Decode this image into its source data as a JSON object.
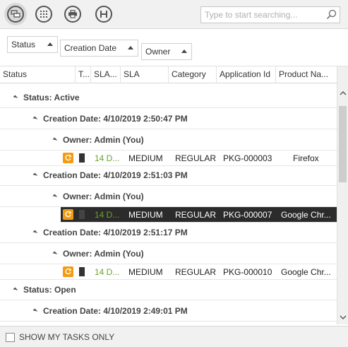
{
  "toolbar": {
    "buttons": [
      {
        "name": "expand-all-icon",
        "active": true
      },
      {
        "name": "columns-icon",
        "active": false
      },
      {
        "name": "print-icon",
        "active": false
      },
      {
        "name": "history-icon",
        "active": false
      }
    ],
    "search_placeholder": "Type to start searching..."
  },
  "group_by": [
    "Status",
    "Creation Date",
    "Owner"
  ],
  "columns": [
    "Status",
    "T...",
    "SLA...",
    "SLA",
    "Category",
    "Application Id",
    "Product Na..."
  ],
  "rows": [
    {
      "kind": "group",
      "level": 0,
      "label": "Status: Active"
    },
    {
      "kind": "group",
      "level": 1,
      "label": "Creation Date: 4/10/2019 2:50:47 PM"
    },
    {
      "kind": "group",
      "level": 2,
      "label": "Owner: Admin (You)"
    },
    {
      "kind": "data",
      "sla_due": "14 D...",
      "sla": "MEDIUM",
      "category": "REGULAR",
      "app_id": "PKG-000003",
      "product": "Firefox",
      "selected": false
    },
    {
      "kind": "group",
      "level": 1,
      "label": "Creation Date: 4/10/2019 2:51:03 PM"
    },
    {
      "kind": "group",
      "level": 2,
      "label": "Owner: Admin (You)"
    },
    {
      "kind": "data",
      "sla_due": "14 D...",
      "sla": "MEDIUM",
      "category": "REGULAR",
      "app_id": "PKG-000007",
      "product": "Google Chr...",
      "selected": true
    },
    {
      "kind": "group",
      "level": 1,
      "label": "Creation Date: 4/10/2019 2:51:17 PM"
    },
    {
      "kind": "group",
      "level": 2,
      "label": "Owner: Admin (You)"
    },
    {
      "kind": "data",
      "sla_due": "14 D...",
      "sla": "MEDIUM",
      "category": "REGULAR",
      "app_id": "PKG-000010",
      "product": "Google Chr...",
      "selected": false
    },
    {
      "kind": "group",
      "level": 0,
      "label": "Status: Open"
    },
    {
      "kind": "group",
      "level": 1,
      "label": "Creation Date: 4/10/2019 2:49:01 PM"
    }
  ],
  "footer": {
    "show_my_tasks_label": "SHOW MY TASKS ONLY",
    "checked": false
  },
  "colors": {
    "accent_orange": "#f39c12",
    "sla_green": "#6aa22d",
    "selected_row": "#2b2b2b"
  }
}
